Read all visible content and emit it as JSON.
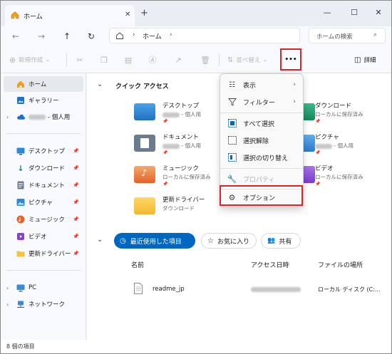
{
  "tab": {
    "title": "ホーム"
  },
  "address": {
    "crumb": "ホーム"
  },
  "search": {
    "placeholder": "ホームの検索"
  },
  "toolbar": {
    "new_label": "新規作成",
    "sort_label": "並べ替え",
    "more_label": "•••",
    "details_label": "詳細"
  },
  "sidebar": {
    "items": [
      {
        "label": "ホーム"
      },
      {
        "label": "ギャラリー"
      },
      {
        "label": "- 個人用"
      },
      {
        "label": "デスクトップ"
      },
      {
        "label": "ダウンロード"
      },
      {
        "label": "ドキュメント"
      },
      {
        "label": "ピクチャ"
      },
      {
        "label": "ミュージック"
      },
      {
        "label": "ビデオ"
      },
      {
        "label": "更新ドライバー"
      },
      {
        "label": "PC"
      },
      {
        "label": "ネットワーク"
      }
    ]
  },
  "quick": {
    "header": "クイック アクセス",
    "folders": [
      {
        "name": "デスクトップ",
        "sub": "- 個人用"
      },
      {
        "name": "ドキュメント",
        "sub": "- 個人用"
      },
      {
        "name": "ミュージック",
        "sub": "ローカルに保存済み"
      },
      {
        "name": "更新ドライバー",
        "sub": "ダウンロード"
      },
      {
        "name": "ダウンロード",
        "sub": "ローカルに保存済み"
      },
      {
        "name": "ピクチャ",
        "sub": "- 個人用"
      },
      {
        "name": "ビデオ",
        "sub": "ローカルに保存済み"
      }
    ]
  },
  "recent": {
    "tabs": [
      "最近使用した項目",
      "お気に入り",
      "共有"
    ],
    "columns": [
      "名前",
      "アクセス日時",
      "ファイルの場所"
    ],
    "rows": [
      {
        "name": "readme_jp",
        "location": "ローカル ディスク (C:..."
      }
    ]
  },
  "menu": {
    "items": [
      {
        "label": "表示"
      },
      {
        "label": "フィルター"
      },
      {
        "label": "すべて選択"
      },
      {
        "label": "選択解除"
      },
      {
        "label": "選択の切り替え"
      },
      {
        "label": "プロパティ"
      },
      {
        "label": "オプション"
      }
    ]
  },
  "status": {
    "text": "8 個の項目"
  },
  "colors": {
    "accent": "#0067c0",
    "highlight": "#d9262b"
  }
}
